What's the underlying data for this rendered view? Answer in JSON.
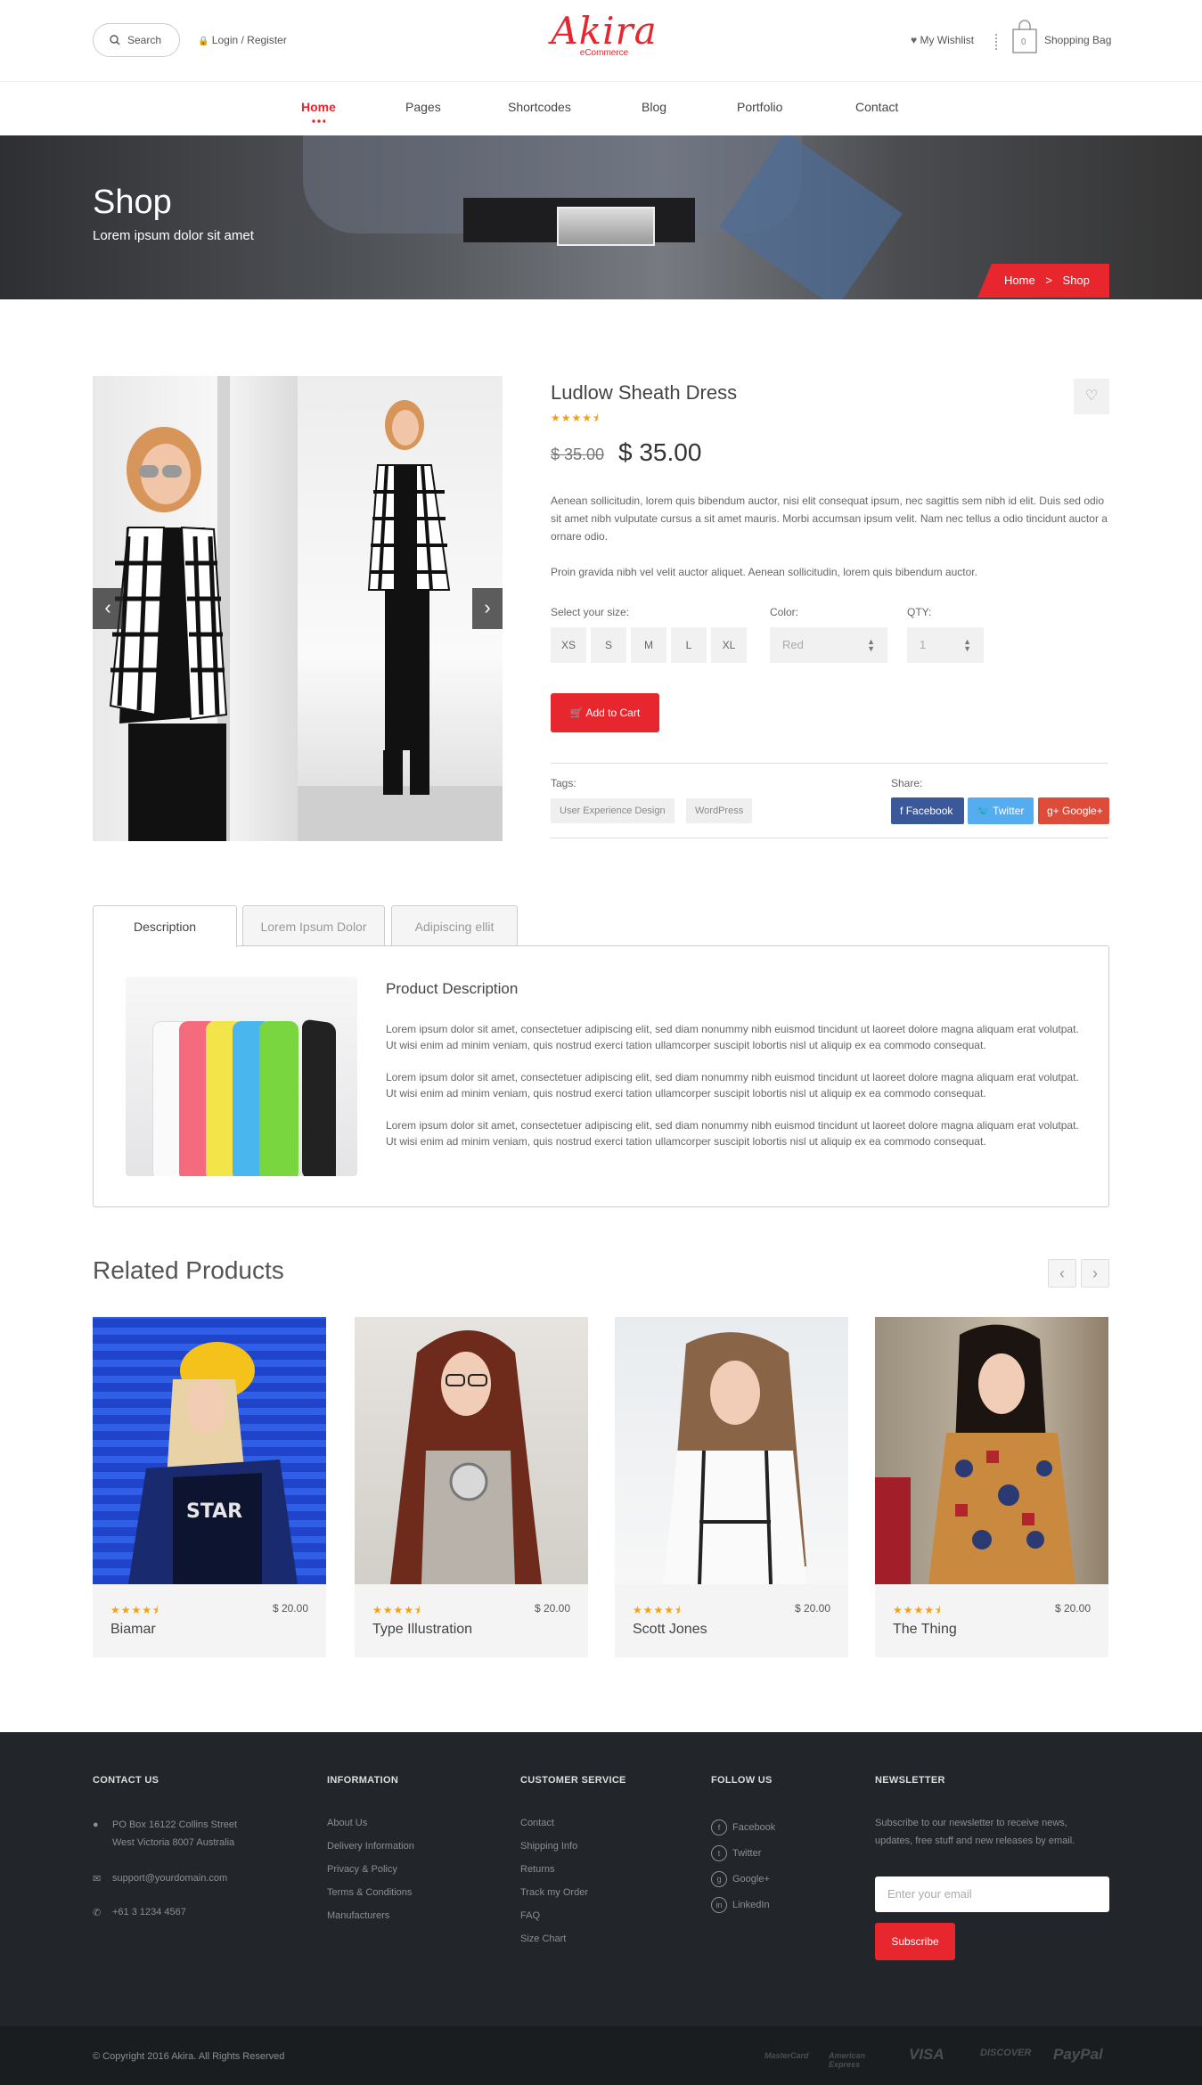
{
  "header": {
    "search_label": "Search",
    "login_label": "Login / Register",
    "logo_text": "Akira",
    "logo_sub": "eCommerce",
    "wishlist_label": "My Wishlist",
    "bag_count": "0",
    "bag_label": "Shopping Bag"
  },
  "nav": {
    "items": [
      "Home",
      "Pages",
      "Shortcodes",
      "Blog",
      "Portfolio",
      "Contact"
    ],
    "active": "Home"
  },
  "hero": {
    "title": "Shop",
    "subtitle": "Lorem ipsum dolor sit amet",
    "breadcrumb": [
      "Home",
      "Shop"
    ],
    "breadcrumb_sep": ">"
  },
  "product": {
    "title": "Ludlow Sheath Dress",
    "rating": 4.5,
    "old_price": "$ 35.00",
    "price": "$ 35.00",
    "description_1": "Aenean sollicitudin, lorem quis bibendum auctor, nisi elit consequat ipsum, nec sagittis sem nibh id elit. Duis sed odio sit amet nibh vulputate cursus a sit amet mauris. Morbi accumsan ipsum velit. Nam nec tellus a odio tincidunt auctor a ornare odio.",
    "description_2": "Proin gravida nibh vel velit auctor aliquet. Aenean sollicitudin, lorem quis bibendum auctor.",
    "size_label": "Select your size:",
    "sizes": [
      "XS",
      "S",
      "M",
      "L",
      "XL"
    ],
    "color_label": "Color:",
    "color_value": "Red",
    "qty_label": "QTY:",
    "qty_value": "1",
    "add_to_cart": "Add to Cart",
    "tags_label": "Tags:",
    "tags": [
      "User Experience Design",
      "WordPress"
    ],
    "share_label": "Share:",
    "share": [
      {
        "label": "Facebook",
        "color": "#3b5998"
      },
      {
        "label": "Twitter",
        "color": "#55acee"
      },
      {
        "label": "Google+",
        "color": "#dd4b39"
      }
    ]
  },
  "tabs": {
    "items": [
      "Description",
      "Lorem Ipsum Dolor",
      "Adipiscing ellit"
    ],
    "active": "Description",
    "panel_title": "Product Description",
    "paragraphs": [
      "Lorem ipsum dolor sit amet, consectetuer adipiscing elit, sed diam nonummy nibh euismod tincidunt ut laoreet dolore magna aliquam erat volutpat. Ut wisi enim ad minim veniam, quis nostrud exerci tation ullamcorper suscipit lobortis nisl ut aliquip ex ea commodo consequat.",
      "Lorem ipsum dolor sit amet, consectetuer adipiscing elit, sed diam nonummy nibh euismod tincidunt ut laoreet dolore magna aliquam erat volutpat. Ut wisi enim ad minim veniam, quis nostrud exerci tation ullamcorper suscipit lobortis nisl ut aliquip ex ea commodo consequat.",
      "Lorem ipsum dolor sit amet, consectetuer adipiscing elit, sed diam nonummy nibh euismod tincidunt ut laoreet dolore magna aliquam erat volutpat. Ut wisi enim ad minim veniam, quis nostrud exerci tation ullamcorper suscipit lobortis nisl ut aliquip ex ea commodo consequat."
    ]
  },
  "related": {
    "title": "Related Products",
    "items": [
      {
        "name": "Biamar",
        "price": "$ 20.00",
        "rating": 4.5
      },
      {
        "name": "Type Illustration",
        "price": "$ 20.00",
        "rating": 4.5
      },
      {
        "name": "Scott Jones",
        "price": "$ 20.00",
        "rating": 4.5
      },
      {
        "name": "The Thing",
        "price": "$ 20.00",
        "rating": 4.5
      }
    ]
  },
  "footer": {
    "contact": {
      "heading": "CONTACT US",
      "address_1": "PO Box 16122 Collins Street",
      "address_2": "West Victoria 8007 Australia",
      "email": "support@yourdomain.com",
      "phone": "+61 3 1234 4567"
    },
    "information": {
      "heading": "INFORMATION",
      "links": [
        "About Us",
        "Delivery Information",
        "Privacy & Policy",
        "Terms & Conditions",
        "Manufacturers"
      ]
    },
    "customer_service": {
      "heading": "CUSTOMER SERVICE",
      "links": [
        "Contact",
        "Shipping Info",
        "Returns",
        "Track my Order",
        "FAQ",
        "Size Chart"
      ]
    },
    "follow": {
      "heading": "FOLLOW US",
      "links": [
        "Facebook",
        "Twitter",
        "Google+",
        "LinkedIn"
      ]
    },
    "newsletter": {
      "heading": "NEWSLETTER",
      "text_1": "Subscribe to our newsletter to receive news,",
      "text_2": "updates, free stuff and new releases by email.",
      "placeholder": "Enter your email",
      "button": "Subscribe"
    },
    "copyright": "© Copyright 2016 Akira. All Rights Reserved",
    "payments": [
      "MasterCard",
      "American Express",
      "VISA",
      "DISCOVER",
      "PayPal"
    ]
  },
  "colors": {
    "accent": "#e8262d",
    "footer_bg": "#22262a",
    "star": "#f0a01a"
  }
}
